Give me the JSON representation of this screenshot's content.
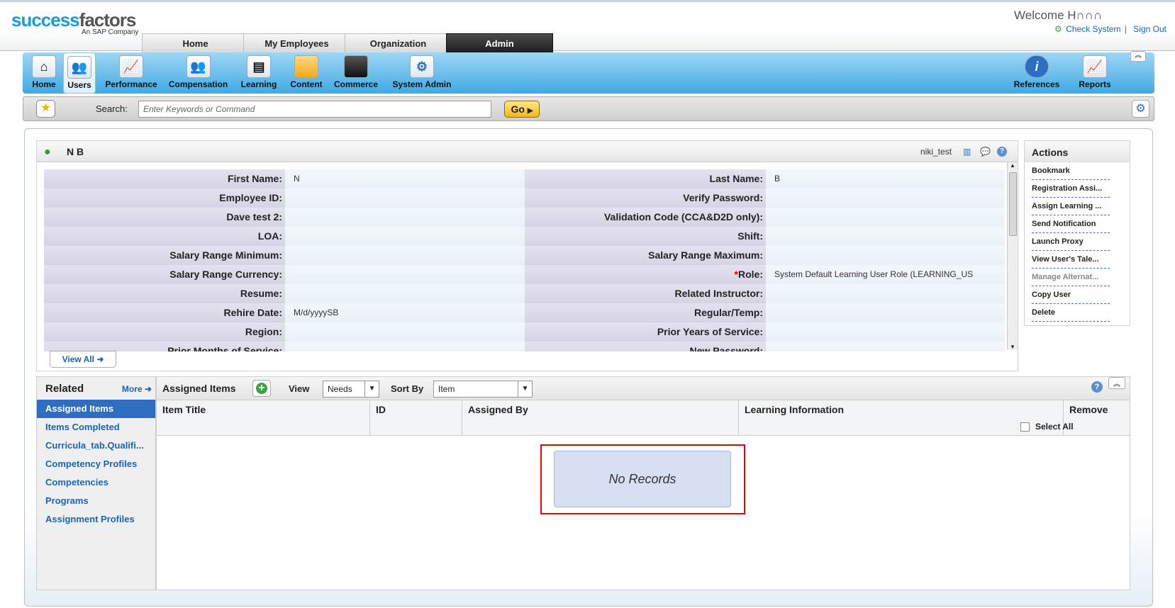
{
  "brand": {
    "logo_part1": "success",
    "logo_part2": "factors",
    "sub": "An SAP Company"
  },
  "header": {
    "welcome": "Welcome H∩∩∩",
    "check_system": "Check System",
    "sign_out": "Sign Out",
    "separator": "|"
  },
  "main_tabs": [
    {
      "label": "Home"
    },
    {
      "label": "My Employees"
    },
    {
      "label": "Organization"
    },
    {
      "label": "Admin",
      "active": true
    }
  ],
  "modules": [
    {
      "label": "Home",
      "icon": "house-icon"
    },
    {
      "label": "Users",
      "icon": "users-icon",
      "active": true
    },
    {
      "label": "Performance",
      "icon": "chart-icon"
    },
    {
      "label": "Compensation",
      "icon": "people-money-icon"
    },
    {
      "label": "Learning",
      "icon": "document-icon"
    },
    {
      "label": "Content",
      "icon": "folder-icon"
    },
    {
      "label": "Commerce",
      "icon": "briefcase-icon"
    },
    {
      "label": "System Admin",
      "icon": "admin-gear-icon"
    },
    {
      "label": "References",
      "icon": "info-icon"
    },
    {
      "label": "Reports",
      "icon": "report-chart-icon"
    }
  ],
  "search": {
    "label": "Search:",
    "placeholder": "Enter Keywords or Command",
    "go": "Go"
  },
  "profile": {
    "name": "N B",
    "username": "niki_test",
    "fields": [
      {
        "label": "First Name:",
        "value": "N",
        "label2": "Last Name:",
        "value2": "B"
      },
      {
        "label": "Employee ID:",
        "value": "",
        "label2": "Verify Password:",
        "value2": ""
      },
      {
        "label": "Dave test 2:",
        "value": "",
        "label2": "Validation Code (CCA&D2D only):",
        "value2": ""
      },
      {
        "label": "LOA:",
        "value": "",
        "label2": "Shift:",
        "value2": ""
      },
      {
        "label": "Salary Range Minimum:",
        "value": "",
        "label2": "Salary Range Maximum:",
        "value2": ""
      },
      {
        "label": "Salary Range Currency:",
        "value": "",
        "label2": "Role:",
        "value2": "System Default Learning User Role (LEARNING_US",
        "required2": "*"
      },
      {
        "label": "Resume:",
        "value": "",
        "label2": "Related Instructor:",
        "value2": ""
      },
      {
        "label": "Rehire Date:",
        "value": "M/d/yyyySB",
        "label2": "Regular/Temp:",
        "value2": ""
      },
      {
        "label": "Region:",
        "value": "",
        "label2": "Prior Years of Service:",
        "value2": ""
      },
      {
        "label": "Prior Months of Service:",
        "value": "",
        "label2": "New Password:",
        "value2": ""
      }
    ],
    "view_all": "View All"
  },
  "actions": {
    "title": "Actions",
    "items": [
      {
        "label": "Bookmark"
      },
      {
        "label": "Registration Assi..."
      },
      {
        "label": "Assign Learning ..."
      },
      {
        "label": "Send Notification"
      },
      {
        "label": "Launch Proxy"
      },
      {
        "label": "View User's Tale..."
      },
      {
        "label": "Manage Alternat...",
        "disabled": true
      },
      {
        "label": "Copy User"
      },
      {
        "label": "Delete"
      }
    ]
  },
  "related": {
    "title": "Related",
    "more": "More",
    "items": [
      {
        "label": "Assigned Items",
        "active": true
      },
      {
        "label": "Items Completed"
      },
      {
        "label": "Curricula_tab.Qualifi..."
      },
      {
        "label": "Competency Profiles"
      },
      {
        "label": "Competencies"
      },
      {
        "label": "Programs"
      },
      {
        "label": "Assignment Profiles"
      }
    ]
  },
  "assigned": {
    "title": "Assigned Items",
    "view_label": "View",
    "view_value": "Needs",
    "sort_label": "Sort By",
    "sort_value": "Item",
    "columns": [
      "Item Title",
      "ID",
      "Assigned By",
      "Learning Information",
      "Remove"
    ],
    "select_all": "Select All",
    "empty": "No Records"
  },
  "colors": {
    "accent": "#2e6dbf",
    "highlight": "#e00000"
  }
}
